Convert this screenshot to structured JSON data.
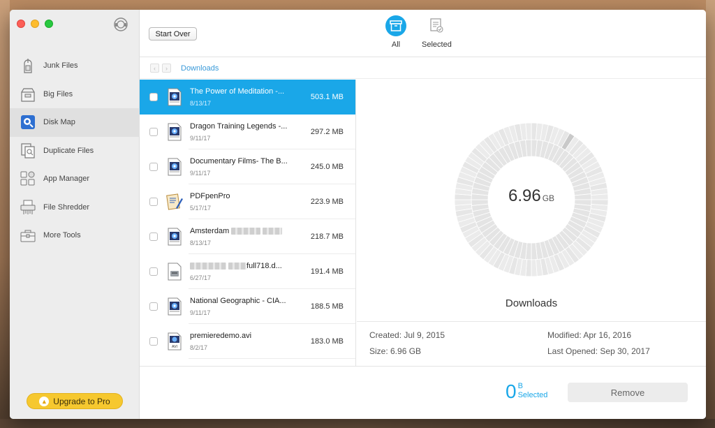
{
  "sidebar": {
    "items": [
      {
        "label": "Junk Files",
        "icon": "vacuum-icon",
        "active": false
      },
      {
        "label": "Big Files",
        "icon": "box-icon",
        "active": false
      },
      {
        "label": "Disk Map",
        "icon": "disk-map-icon",
        "active": true
      },
      {
        "label": "Duplicate Files",
        "icon": "duplicate-icon",
        "active": false
      },
      {
        "label": "App Manager",
        "icon": "apps-icon",
        "active": false
      },
      {
        "label": "File Shredder",
        "icon": "shredder-icon",
        "active": false
      },
      {
        "label": "More Tools",
        "icon": "toolbox-icon",
        "active": false
      }
    ],
    "upgrade_label": "Upgrade to Pro"
  },
  "toolbar": {
    "start_over_label": "Start Over",
    "tabs": [
      {
        "label": "All",
        "active": true
      },
      {
        "label": "Selected",
        "active": false
      }
    ]
  },
  "breadcrumb": {
    "current": "Downloads"
  },
  "files": [
    {
      "name": "The Power of Meditation -...",
      "date": "8/13/17",
      "size": "503.1 MB",
      "icon": "video-file-icon",
      "selected": true
    },
    {
      "name": "Dragon Training Legends -...",
      "date": "9/11/17",
      "size": "297.2 MB",
      "icon": "video-file-icon",
      "selected": false
    },
    {
      "name": "Documentary Films- The B...",
      "date": "9/11/17",
      "size": "245.0 MB",
      "icon": "video-file-icon",
      "selected": false
    },
    {
      "name": "PDFpenPro",
      "date": "5/17/17",
      "size": "223.9 MB",
      "icon": "pdfpen-app-icon",
      "selected": false
    },
    {
      "name": "Amsterdam",
      "date": "8/13/17",
      "size": "218.7 MB",
      "icon": "video-file-icon",
      "selected": false
    },
    {
      "name": "full718.d...",
      "date": "6/27/17",
      "size": "191.4 MB",
      "icon": "disk-image-icon",
      "selected": false
    },
    {
      "name": "National Geographic - CIA...",
      "date": "9/11/17",
      "size": "188.5 MB",
      "icon": "video-file-icon",
      "selected": false
    },
    {
      "name": "premieredemo.avi",
      "date": "8/2/17",
      "size": "183.0 MB",
      "icon": "avi-file-icon",
      "selected": false
    }
  ],
  "detail": {
    "total_value": "6.96",
    "total_unit": "GB",
    "folder_name": "Downloads",
    "created": "Created: Jul 9, 2015",
    "modified": "Modified: Apr 16, 2016",
    "size": "Size: 6.96 GB",
    "last_opened": "Last Opened: Sep 30, 2017"
  },
  "bottom": {
    "selected_value": "0",
    "selected_unit": "B",
    "selected_label": "Selected",
    "remove_label": "Remove"
  },
  "colors": {
    "accent": "#1aa7e8",
    "upgrade": "#f6c82f",
    "traffic_red": "#fc5f57",
    "traffic_yellow": "#fdbc2e",
    "traffic_green": "#28c840"
  }
}
